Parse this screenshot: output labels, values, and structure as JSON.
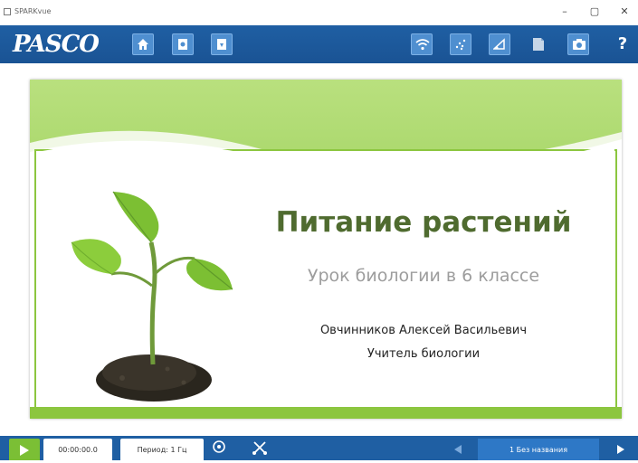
{
  "window": {
    "title": "SPARKvue",
    "minimize": "–",
    "maximize": "▢",
    "close": "✕"
  },
  "toolbar": {
    "logo": "PASCO",
    "help": "?"
  },
  "slide": {
    "title": "Питание растений",
    "subtitle": "Урок биологии в 6 классе",
    "author": "Овчинников Алексей Васильевич",
    "role": "Учитель биологии"
  },
  "statusbar": {
    "time": "00:00:00.0",
    "rate": "Период: 1 Гц",
    "page_label": "1 Без названия"
  },
  "colors": {
    "toolbar": "#1f5fa3",
    "slide_green": "#8cc63f",
    "title_green": "#4f6b2f",
    "play_green": "#7bbf35"
  }
}
